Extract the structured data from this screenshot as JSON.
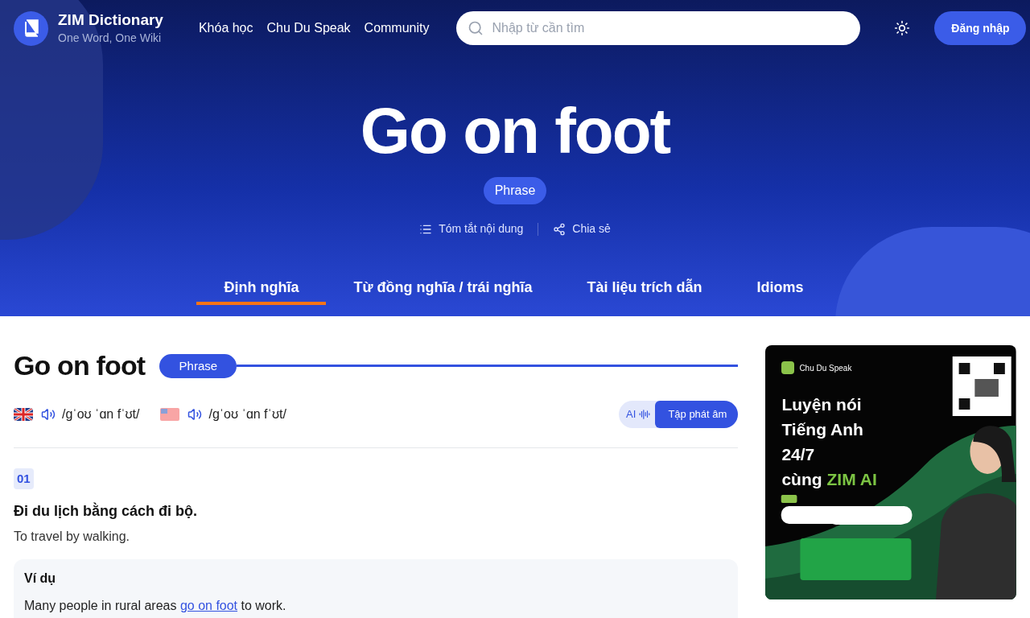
{
  "brand": {
    "name": "ZIM Dictionary",
    "tagline": "One Word, One Wiki"
  },
  "nav": [
    "Khóa học",
    "Chu Du Speak",
    "Community"
  ],
  "search": {
    "placeholder": "Nhập từ cần tìm"
  },
  "login": "Đăng nhập",
  "hero": {
    "title": "Go on foot",
    "badge": "Phrase",
    "actions": [
      "Tóm tắt nội dung",
      "Chia sẻ"
    ]
  },
  "tabs": [
    {
      "label": "Định nghĩa",
      "selected": true
    },
    {
      "label": "Từ đồng nghĩa / trái nghĩa",
      "selected": false
    },
    {
      "label": "Tài liệu trích dẫn",
      "selected": false
    },
    {
      "label": "Idioms",
      "selected": false
    }
  ],
  "entry": {
    "title": "Go on foot",
    "badge": "Phrase",
    "pronunciations": [
      {
        "kind": "uk",
        "ipa": "/ɡˈoʊ ˈɑn fˈʊt/"
      },
      {
        "kind": "us",
        "ipa": "/ɡˈoʊ ˈɑn fˈʊt/"
      }
    ],
    "ai_label": "AI",
    "practice": "Tập phát âm",
    "senses": [
      {
        "number": "01",
        "vi": "Đi du lịch bằng cách đi bộ.",
        "en": "To travel by walking.",
        "example_heading": "Ví dụ",
        "example_before": "Many people in rural areas ",
        "example_link": "go on foot",
        "example_after": " to work."
      }
    ]
  },
  "ad": {
    "brand": "Chu Du Speak",
    "headline": [
      "Luyện nói",
      "Tiếng Anh",
      "24/7"
    ],
    "last_line": "cùng",
    "highlight": "ZIM AI"
  }
}
